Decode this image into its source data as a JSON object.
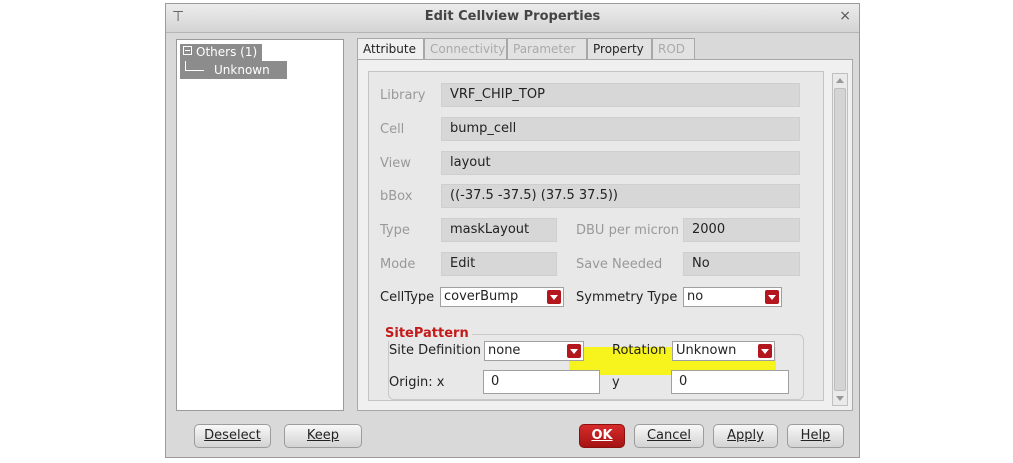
{
  "window": {
    "title": "Edit Cellview Properties",
    "close_label": "×"
  },
  "tree": {
    "root_label": "Others (1)",
    "child_label": "Unknown"
  },
  "tabs": [
    {
      "label": "Attribute",
      "state": "active"
    },
    {
      "label": "Connectivity",
      "state": "disabled"
    },
    {
      "label": "Parameter",
      "state": "disabled"
    },
    {
      "label": "Property",
      "state": "enabled"
    },
    {
      "label": "ROD",
      "state": "disabled"
    }
  ],
  "attributes": {
    "library_label": "Library",
    "library_value": "VRF_CHIP_TOP",
    "cell_label": "Cell",
    "cell_value": "bump_cell",
    "view_label": "View",
    "view_value": "layout",
    "bbox_label": "bBox",
    "bbox_value": "((-37.5 -37.5) (37.5 37.5))",
    "type_label": "Type",
    "type_value": "maskLayout",
    "dbu_label": "DBU per micron",
    "dbu_value": "2000",
    "mode_label": "Mode",
    "mode_value": "Edit",
    "save_label": "Save Needed",
    "save_value": "No",
    "celltype_label": "CellType",
    "celltype_value": "coverBump",
    "symmetry_label": "Symmetry Type",
    "symmetry_value": "no"
  },
  "site_pattern": {
    "title": "SitePattern",
    "site_def_label": "Site Definition",
    "site_def_value": "none",
    "rotation_label": "Rotation",
    "rotation_value": "Unknown",
    "origin_x_label": "Origin: x",
    "origin_x_value": "0",
    "origin_y_label": "y",
    "origin_y_value": "0"
  },
  "buttons": {
    "deselect": "Deselect",
    "keep": "Keep",
    "ok": "OK",
    "cancel": "Cancel",
    "apply": "Apply",
    "help": "Help"
  },
  "colors": {
    "highlight": "#f7f31c",
    "annotation_arrow": "#e8413b",
    "accent_red": "#b3161d"
  }
}
